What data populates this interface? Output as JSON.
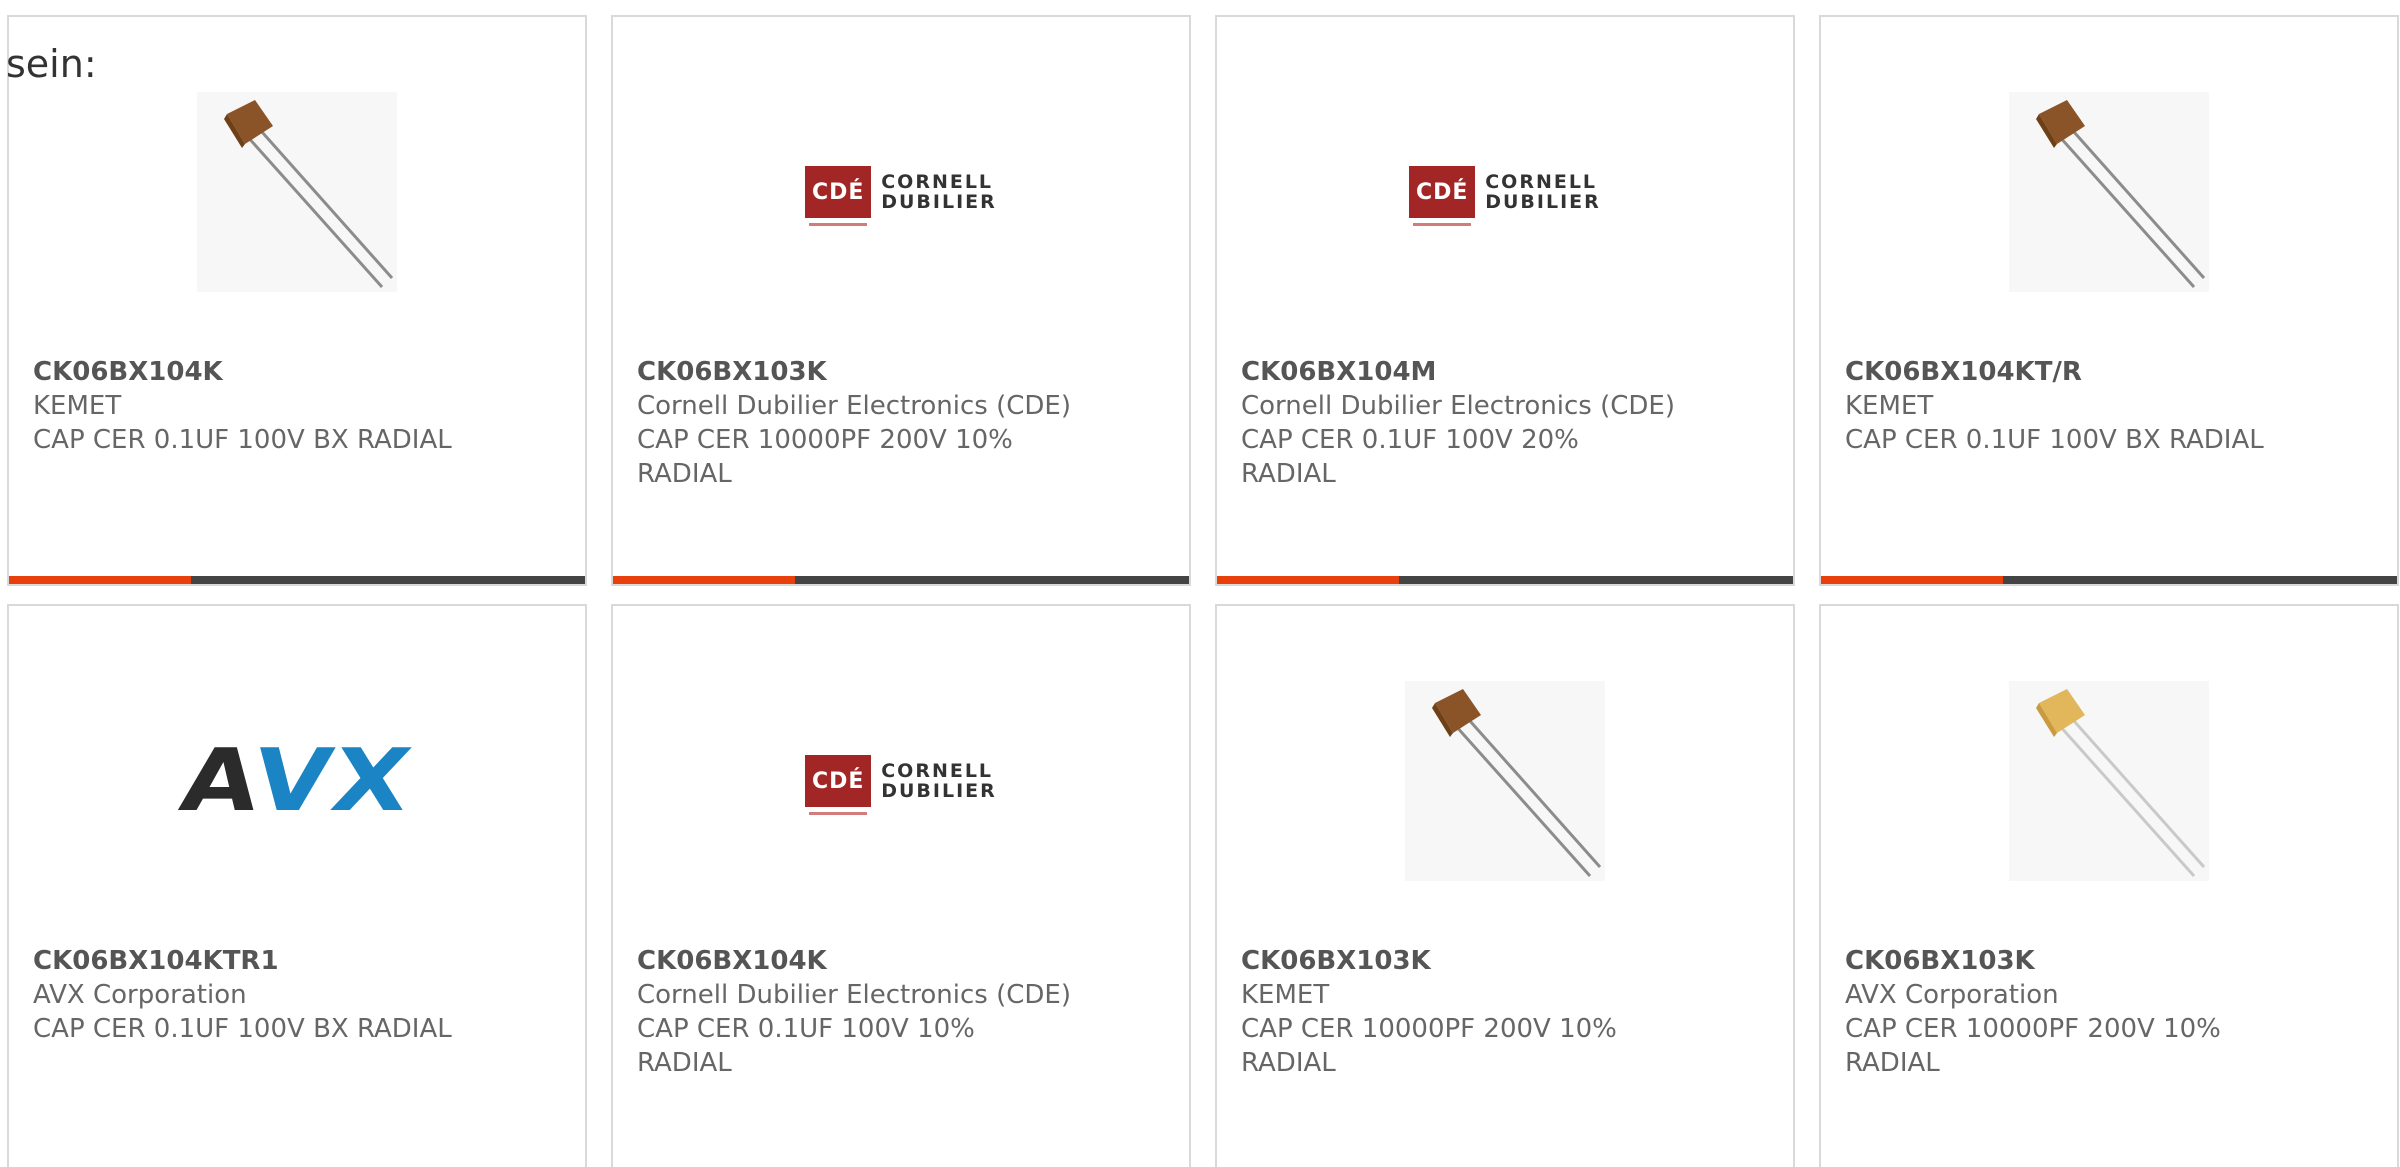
{
  "intro_text": "sein:",
  "colors": {
    "accent": "#e8400c",
    "bar_dark": "#444444",
    "cde_red": "#a32626",
    "avx_blue": "#1b84c4",
    "capacitor_brown": "#8a5428",
    "capacitor_yellow": "#e2b65a"
  },
  "cards": [
    {
      "part_number": "CK06BX104K",
      "manufacturer": "KEMET",
      "description": "CAP CER 0.1UF 100V BX RADIAL",
      "image": "capacitor-brown-photo"
    },
    {
      "part_number": "CK06BX103K",
      "manufacturer": "Cornell Dubilier Electronics (CDE)",
      "description": "CAP CER 10000PF 200V 10% RADIAL",
      "image": "cde-logo"
    },
    {
      "part_number": "CK06BX104M",
      "manufacturer": "Cornell Dubilier Electronics (CDE)",
      "description": "CAP CER 0.1UF 100V 20% RADIAL",
      "image": "cde-logo"
    },
    {
      "part_number": "CK06BX104KT/R",
      "manufacturer": "KEMET",
      "description": "CAP CER 0.1UF 100V BX RADIAL",
      "image": "capacitor-brown-photo"
    },
    {
      "part_number": "CK06BX104KTR1",
      "manufacturer": "AVX Corporation",
      "description": "CAP CER 0.1UF 100V BX RADIAL",
      "image": "avx-logo"
    },
    {
      "part_number": "CK06BX104K",
      "manufacturer": "Cornell Dubilier Electronics (CDE)",
      "description": "CAP CER 0.1UF 100V 10% RADIAL",
      "image": "cde-logo"
    },
    {
      "part_number": "CK06BX103K",
      "manufacturer": "KEMET",
      "description": "CAP CER 10000PF 200V 10% RADIAL",
      "image": "capacitor-brown-photo"
    },
    {
      "part_number": "CK06BX103K",
      "manufacturer": "AVX Corporation",
      "description": "CAP CER 10000PF 200V 10% RADIAL",
      "image": "capacitor-yellow-photo"
    }
  ],
  "logos": {
    "cde_box": "CDÉ",
    "cde_line1": "CORNELL",
    "cde_line2": "DUBILIER",
    "avx": "AVX"
  }
}
